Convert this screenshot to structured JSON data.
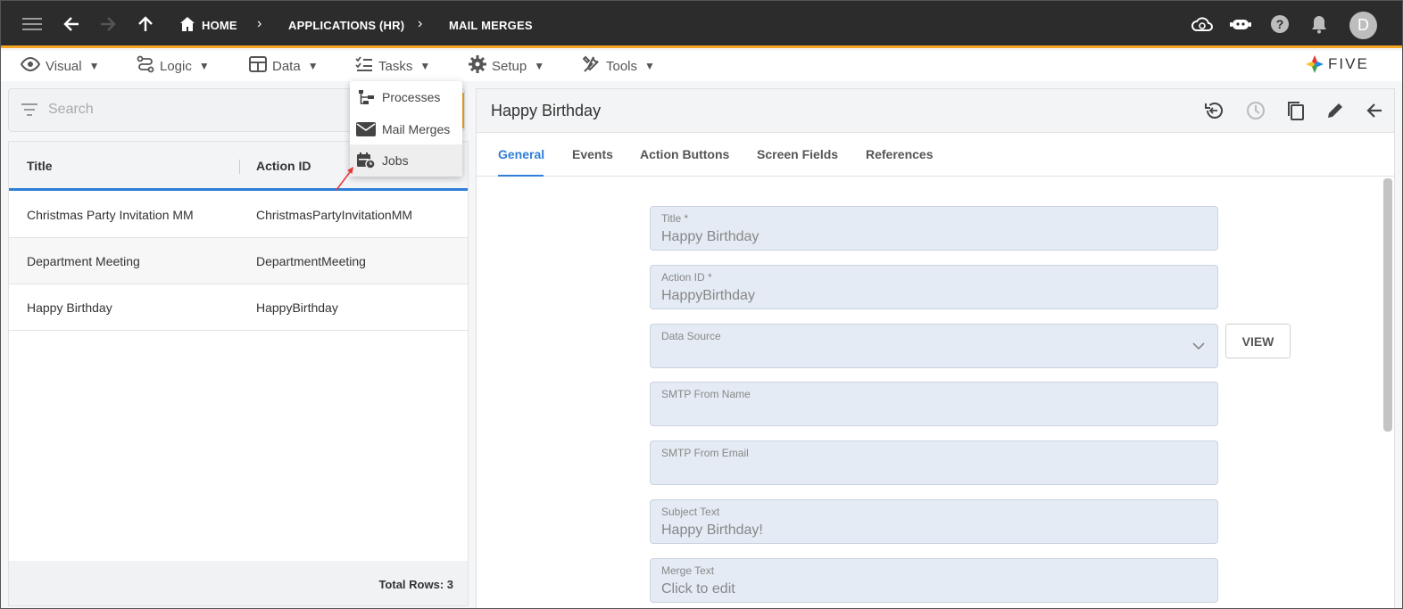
{
  "topbar": {
    "breadcrumbs": [
      "HOME",
      "APPLICATIONS (HR)",
      "MAIL MERGES"
    ],
    "avatar_letter": "D",
    "accent_color": "#f5a623"
  },
  "menubar": {
    "items": [
      {
        "label": "Visual",
        "icon": "eye-icon"
      },
      {
        "label": "Logic",
        "icon": "logic-icon"
      },
      {
        "label": "Data",
        "icon": "table-icon"
      },
      {
        "label": "Tasks",
        "icon": "checklist-icon"
      },
      {
        "label": "Setup",
        "icon": "gear-icon"
      },
      {
        "label": "Tools",
        "icon": "tools-icon"
      }
    ],
    "brand": "FIVE"
  },
  "tasks_dropdown": {
    "items": [
      {
        "label": "Processes",
        "icon": "process-icon"
      },
      {
        "label": "Mail Merges",
        "icon": "mail-icon"
      },
      {
        "label": "Jobs",
        "icon": "job-calendar-icon"
      }
    ]
  },
  "search": {
    "placeholder": "Search"
  },
  "grid": {
    "columns": [
      "Title",
      "Action ID"
    ],
    "rows": [
      {
        "title": "Christmas Party Invitation MM",
        "action_id": "ChristmasPartyInvitationMM"
      },
      {
        "title": "Department Meeting",
        "action_id": "DepartmentMeeting"
      },
      {
        "title": "Happy Birthday",
        "action_id": "HappyBirthday"
      }
    ],
    "footer": "Total Rows: 3"
  },
  "detail": {
    "title": "Happy Birthday",
    "tabs": [
      "General",
      "Events",
      "Action Buttons",
      "Screen Fields",
      "References"
    ],
    "active_tab": "General",
    "fields": [
      {
        "label": "Title *",
        "value": "Happy Birthday"
      },
      {
        "label": "Action ID *",
        "value": "HappyBirthday"
      },
      {
        "label": "Data Source",
        "value": ""
      },
      {
        "label": "SMTP From Name",
        "value": ""
      },
      {
        "label": "SMTP From Email",
        "value": ""
      },
      {
        "label": "Subject Text",
        "value": "Happy Birthday!"
      },
      {
        "label": "Merge Text",
        "value": "Click to edit"
      }
    ],
    "view_button": "VIEW",
    "accent_color": "#2f7ed8"
  }
}
